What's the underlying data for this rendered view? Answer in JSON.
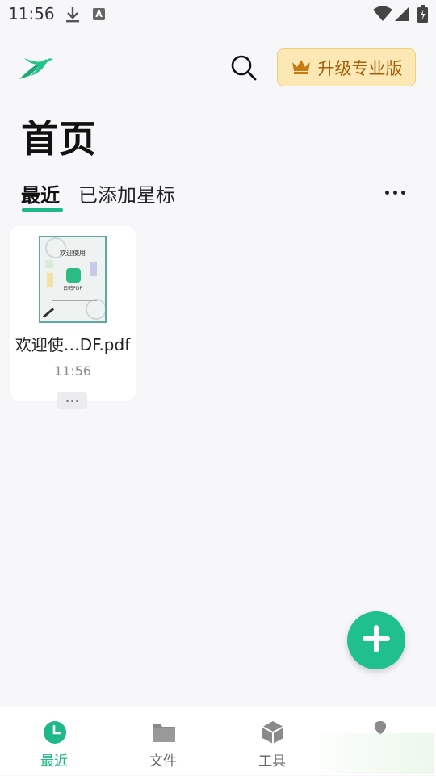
{
  "status_bar": {
    "time": "11:56",
    "a_badge": "A"
  },
  "header": {
    "upgrade_label": "升级专业版"
  },
  "page": {
    "title": "首页"
  },
  "tabs": [
    {
      "label": "最近",
      "active": true
    },
    {
      "label": "已添加星标",
      "active": false
    }
  ],
  "files": [
    {
      "name": "欢迎使…DF.pdf",
      "time": "11:56",
      "thumbnail": {
        "heading": "欢迎使用",
        "app_name": "白鹤PDF"
      }
    }
  ],
  "bottom_nav": [
    {
      "label": "最近",
      "icon": "clock-icon",
      "active": true
    },
    {
      "label": "文件",
      "icon": "folder-icon",
      "active": false
    },
    {
      "label": "工具",
      "icon": "box-icon",
      "active": false
    },
    {
      "label": "",
      "icon": "pin-icon",
      "active": false
    }
  ],
  "colors": {
    "accent": "#1fb88a",
    "fab": "#1fbf8e",
    "upgrade_bg": "#fce8b4",
    "upgrade_text": "#a4600c"
  }
}
